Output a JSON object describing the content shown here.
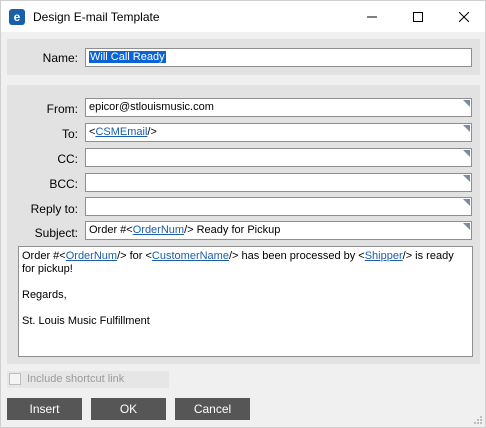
{
  "window": {
    "title": "Design E-mail Template",
    "app_icon_letter": "e",
    "icons": {
      "app": "epicor-app-icon",
      "minimize": "minimize-icon",
      "maximize": "maximize-icon",
      "close": "close-icon",
      "dropdown": "field-corner-icon"
    }
  },
  "name_panel": {
    "label": "Name:",
    "value": "Will Call Ready"
  },
  "fields": {
    "from": {
      "label": "From:",
      "value": "epicor@stlouismusic.com"
    },
    "to": {
      "label": "To:",
      "prefix": "<",
      "tag": "CSMEmail",
      "suffix": "/>"
    },
    "cc": {
      "label": "CC:",
      "value": ""
    },
    "bcc": {
      "label": "BCC:",
      "value": ""
    },
    "reply_to": {
      "label": "Reply to:",
      "value": ""
    },
    "subject": {
      "label": "Subject:",
      "prefix": "Order #<",
      "tag": "OrderNum",
      "suffix": "/> Ready for Pickup"
    }
  },
  "body": {
    "line1_a": "Order #<",
    "tag_order": "OrderNum",
    "line1_b": "/> for <",
    "tag_customer": "CustomerName",
    "line1_c": "/> has been processed by <",
    "tag_shipper": "Shipper",
    "line1_d": "/> is ready for pickup!",
    "line2": "Regards,",
    "line3": "St. Louis Music Fulfillment"
  },
  "options": {
    "include_shortcut_label": "Include shortcut link",
    "include_shortcut_checked": false
  },
  "buttons": {
    "insert": "Insert",
    "ok": "OK",
    "cancel": "Cancel"
  },
  "colors": {
    "accent": "#0a64d6",
    "link": "#1a5fa8",
    "button": "#565656",
    "panel": "#e2e2e2"
  }
}
